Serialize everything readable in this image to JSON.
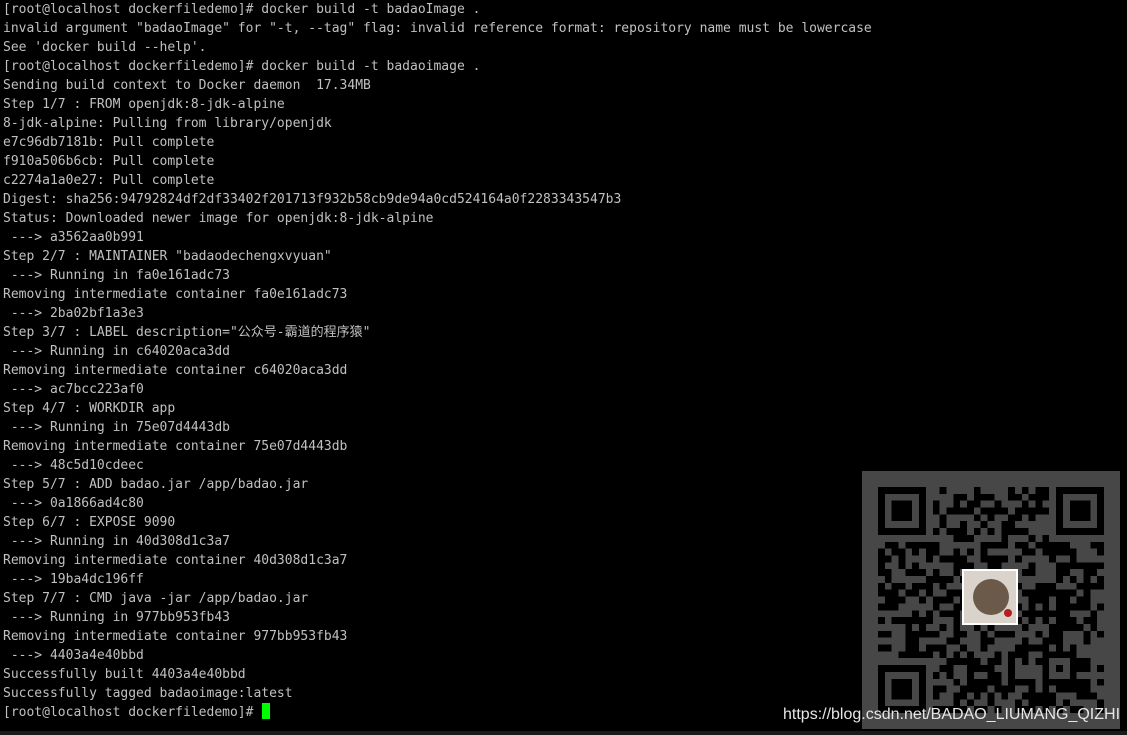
{
  "terminal": {
    "colors": {
      "background": "#000000",
      "text": "#c0c0c0",
      "cursor": "#00ff00"
    },
    "lines": [
      "[root@localhost dockerfiledemo]# docker build -t badaoImage .",
      "invalid argument \"badaoImage\" for \"-t, --tag\" flag: invalid reference format: repository name must be lowercase",
      "See 'docker build --help'.",
      "[root@localhost dockerfiledemo]# docker build -t badaoimage .",
      "Sending build context to Docker daemon  17.34MB",
      "Step 1/7 : FROM openjdk:8-jdk-alpine",
      "8-jdk-alpine: Pulling from library/openjdk",
      "e7c96db7181b: Pull complete",
      "f910a506b6cb: Pull complete",
      "c2274a1a0e27: Pull complete",
      "Digest: sha256:94792824df2df33402f201713f932b58cb9de94a0cd524164a0f2283343547b3",
      "Status: Downloaded newer image for openjdk:8-jdk-alpine",
      " ---> a3562aa0b991",
      "Step 2/7 : MAINTAINER \"badaodechengxvyuan\"",
      " ---> Running in fa0e161adc73",
      "Removing intermediate container fa0e161adc73",
      " ---> 2ba02bf1a3e3",
      "Step 3/7 : LABEL description=\"公众号-霸道的程序猿\"",
      " ---> Running in c64020aca3dd",
      "Removing intermediate container c64020aca3dd",
      " ---> ac7bcc223af0",
      "Step 4/7 : WORKDIR app",
      " ---> Running in 75e07d4443db",
      "Removing intermediate container 75e07d4443db",
      " ---> 48c5d10cdeec",
      "Step 5/7 : ADD badao.jar /app/badao.jar",
      " ---> 0a1866ad4c80",
      "Step 6/7 : EXPOSE 9090",
      " ---> Running in 40d308d1c3a7",
      "Removing intermediate container 40d308d1c3a7",
      " ---> 19ba4dc196ff",
      "Step 7/7 : CMD java -jar /app/badao.jar",
      " ---> Running in 977bb953fb43",
      "Removing intermediate container 977bb953fb43",
      " ---> 4403a4e40bbd",
      "Successfully built 4403a4e40bbd",
      "Successfully tagged badaoimage:latest"
    ],
    "prompt": "[root@localhost dockerfiledemo]# "
  },
  "overlay": {
    "qr_code_icon": "qr-code-icon",
    "background": "#474747",
    "watermark": "https://blog.csdn.net/BADAO_LIUMANG_QIZHI"
  }
}
